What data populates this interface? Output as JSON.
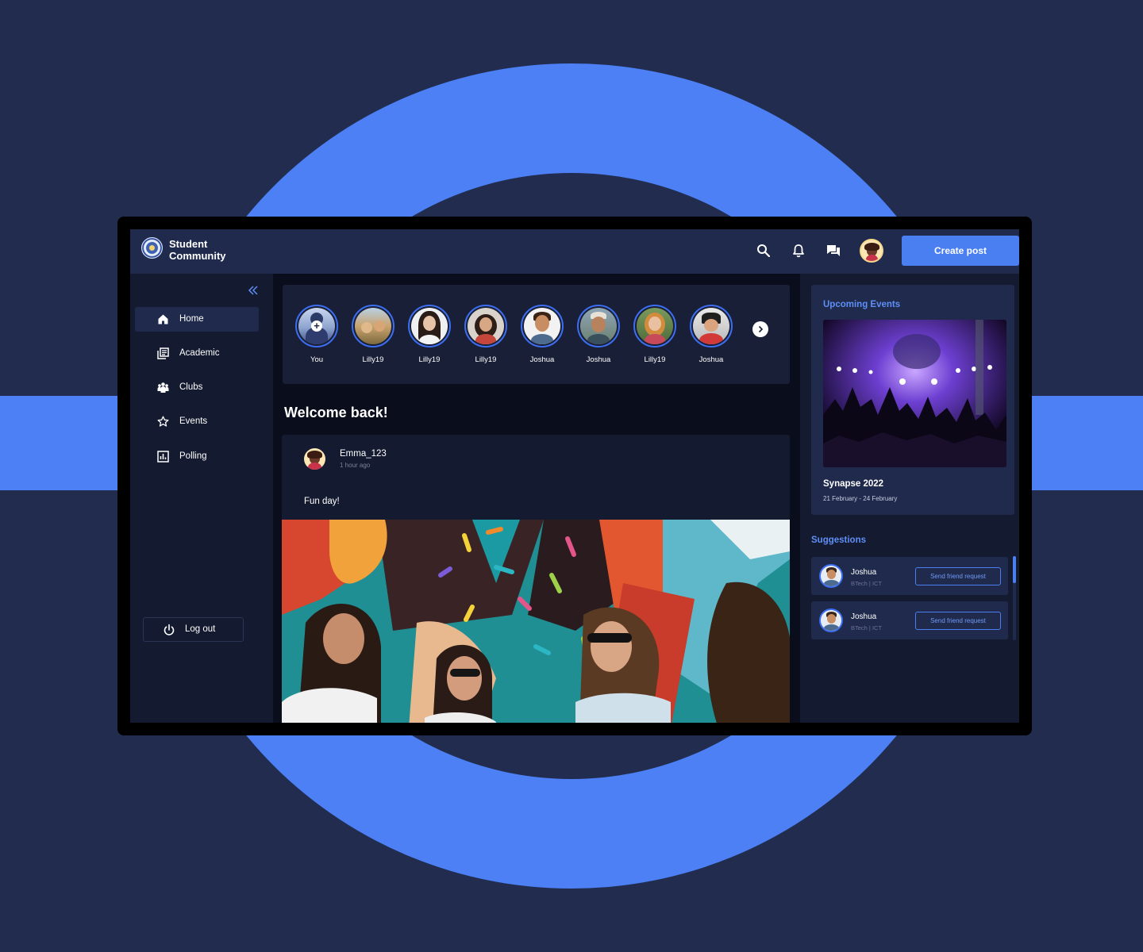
{
  "app": {
    "brand_line1": "Student",
    "brand_line2": "Community"
  },
  "topbar": {
    "icons": [
      "search-icon",
      "bell-icon",
      "chat-icon"
    ],
    "create_post_label": "Create post"
  },
  "sidebar": {
    "items": [
      {
        "label": "Home",
        "icon": "home-icon",
        "active": true
      },
      {
        "label": "Academic",
        "icon": "library-icon",
        "active": false
      },
      {
        "label": "Clubs",
        "icon": "group-icon",
        "active": false
      },
      {
        "label": "Events",
        "icon": "star-icon",
        "active": false
      },
      {
        "label": "Polling",
        "icon": "poll-icon",
        "active": false
      }
    ],
    "logout_label": "Log out"
  },
  "stories": [
    {
      "name": "You"
    },
    {
      "name": "Lilly19"
    },
    {
      "name": "Lilly19"
    },
    {
      "name": "Lilly19"
    },
    {
      "name": "Joshua"
    },
    {
      "name": "Joshua"
    },
    {
      "name": "Lilly19"
    },
    {
      "name": "Joshua"
    }
  ],
  "feed": {
    "welcome": "Welcome back!",
    "post": {
      "user": "Emma_123",
      "time": "1 hour ago",
      "text": "Fun day!"
    }
  },
  "right": {
    "events_title": "Upcoming Events",
    "event": {
      "name": "Synapse 2022",
      "date": "21 February - 24 February"
    },
    "suggestions_title": "Suggestions",
    "suggestions": [
      {
        "name": "Joshua",
        "detail": "BTech | ICT",
        "button": "Send friend request"
      },
      {
        "name": "Joshua",
        "detail": "BTech | ICT",
        "button": "Send friend request"
      }
    ]
  },
  "colors": {
    "accent": "#4a7ff1",
    "background": "#212c4f",
    "panel": "#141a30",
    "topbar": "#1f2a4c"
  }
}
